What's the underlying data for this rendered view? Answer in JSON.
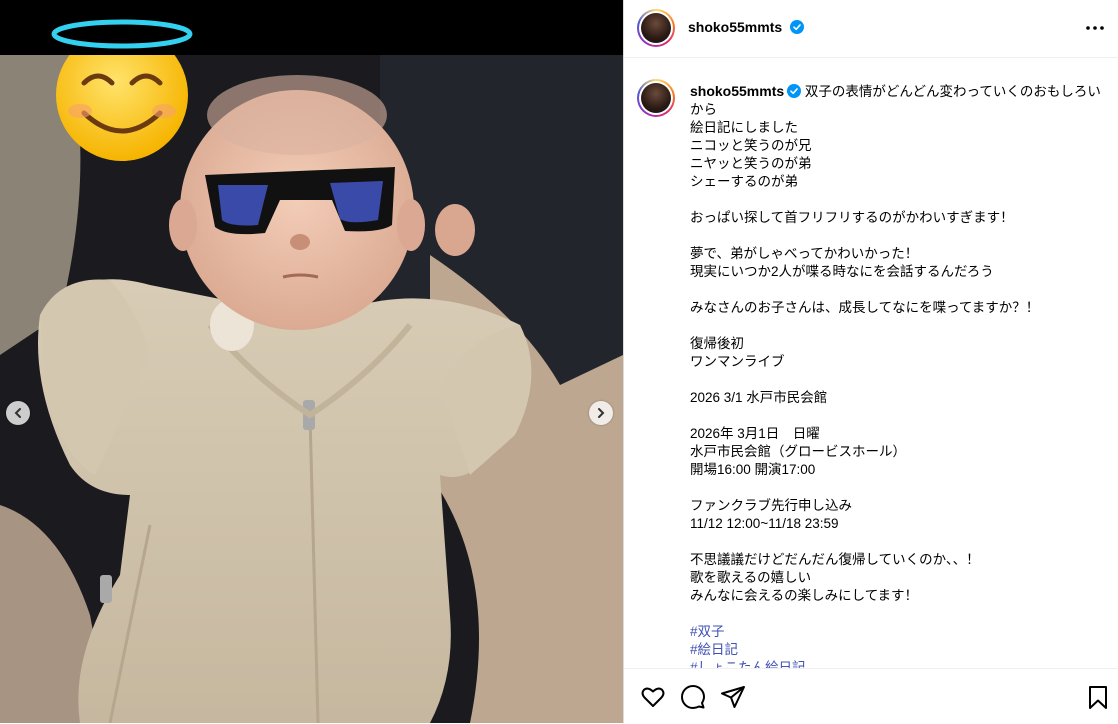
{
  "post": {
    "username": "shoko55mmts",
    "verified": true
  },
  "caption": {
    "first_line": "双子の表情がどんどん変わっていくのおもしろいから",
    "lines": [
      "絵日記にしました",
      "ニコッと笑うのが兄",
      "ニヤッと笑うのが弟",
      "シェーするのが弟",
      "",
      "おっぱい探して首フリフリするのがかわいすぎます！",
      "",
      "夢で、弟がしゃべってかわいかった！",
      "現実にいつか2人が喋る時なにを会話するんだろう",
      "",
      "みなさんのお子さんは、成長してなにを喋ってますか？！",
      "",
      "復帰後初",
      "ワンマンライブ",
      "",
      "2026 3/1 水戸市民会館",
      "",
      "2026年 3月1日　日曜",
      "水戸市民会館（グロービスホール）",
      "開場16:00 開演17:00",
      "",
      "ファンクラブ先行申し込み",
      "11/12 12:00~11/18 23:59",
      "",
      "不思議議だけどだんだん復帰していくのか、、！",
      "歌を歌えるの嬉しい",
      "みんなに会えるの楽しみにしてます！",
      ""
    ],
    "hashtags": [
      "#双子",
      "#絵日記",
      "#しょこたん絵日記"
    ]
  },
  "icons": {
    "more": "more-icon",
    "like": "heart-icon",
    "comment": "comment-icon",
    "share": "share-icon",
    "save": "bookmark-icon",
    "prev": "chevron-left-icon",
    "next": "chevron-right-icon",
    "verified": "verified-badge-icon"
  },
  "colors": {
    "verified": "#0095f6",
    "hashtag": "#4050b5",
    "border": "#dbdbdb"
  }
}
